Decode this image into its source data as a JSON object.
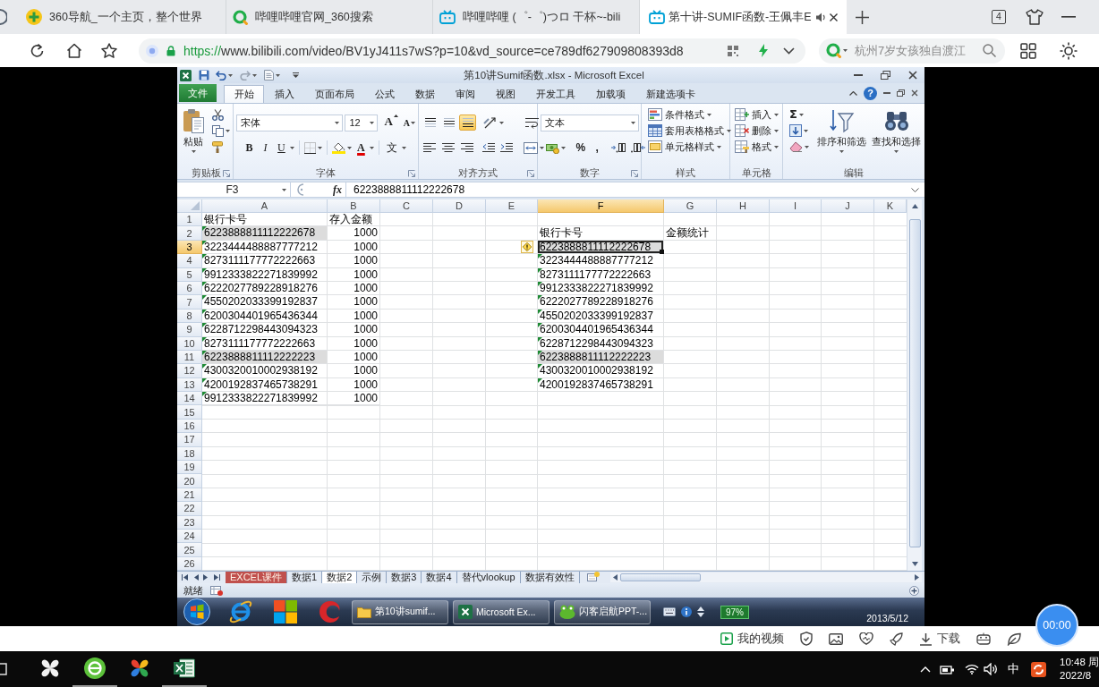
{
  "browser": {
    "tabs": [
      {
        "kind": "portal",
        "title": "360导航_一个主页，整个世界",
        "selected": false,
        "audio": false
      },
      {
        "kind": "search",
        "title": "哔哩哔哩官网_360搜索",
        "selected": false,
        "audio": false
      },
      {
        "kind": "video",
        "title": "哔哩哔哩 (゜-゜)つロ 干杯~-bili",
        "selected": false,
        "audio": false
      },
      {
        "kind": "video",
        "title": "第十讲-SUMIF函数-王佩丰E",
        "selected": true,
        "audio": true
      }
    ],
    "tab_count": "4"
  },
  "address_bar": {
    "scheme": "https://",
    "url": "www.bilibili.com/video/BV1yJ411s7wS?p=10&vd_source=ce789df627909808393d8"
  },
  "search": {
    "placeholder": "杭州7岁女孩独自渡江"
  },
  "excel": {
    "title": "第10讲Sumif函数.xlsx - Microsoft Excel",
    "file_tab": "文件",
    "tabs": [
      {
        "label": "开始",
        "selected": true
      },
      {
        "label": "插入",
        "selected": false
      },
      {
        "label": "页面布局",
        "selected": false
      },
      {
        "label": "公式",
        "selected": false
      },
      {
        "label": "数据",
        "selected": false
      },
      {
        "label": "审阅",
        "selected": false
      },
      {
        "label": "视图",
        "selected": false
      },
      {
        "label": "开发工具",
        "selected": false
      },
      {
        "label": "加载项",
        "selected": false
      },
      {
        "label": "新建选项卡",
        "selected": false
      }
    ],
    "help": "?",
    "ribbon": {
      "clipboard": {
        "label": "剪贴板",
        "paste": "粘贴"
      },
      "font": {
        "label": "字体",
        "font_name": "宋体",
        "font_size": "12",
        "grow": "A",
        "shrink": "A",
        "buttons": [
          {
            "kind": "bold",
            "label": "B"
          },
          {
            "kind": "italic",
            "label": "I"
          },
          {
            "kind": "underline",
            "label": "U"
          },
          {
            "kind": "border"
          },
          {
            "kind": "fill"
          },
          {
            "kind": "color",
            "label": "A"
          },
          {
            "kind": "phonetic",
            "label": "文"
          }
        ]
      },
      "alignment": {
        "label": "对齐方式",
        "vertical": [
          {
            "kind": "top",
            "selected": false
          },
          {
            "kind": "middle",
            "selected": false
          },
          {
            "kind": "bottom",
            "selected": true
          }
        ]
      },
      "number": {
        "label": "数字",
        "format": "文本",
        "percent": "%",
        "comma": ","
      },
      "styles": {
        "label": "样式",
        "items": [
          {
            "kind": "conditional",
            "label": "条件格式"
          },
          {
            "kind": "table",
            "label": "套用表格格式"
          },
          {
            "kind": "cell",
            "label": "单元格样式"
          }
        ]
      },
      "cells": {
        "label": "单元格",
        "items": [
          {
            "kind": "insert",
            "label": "插入"
          },
          {
            "kind": "delete",
            "label": "删除"
          },
          {
            "kind": "format",
            "label": "格式"
          }
        ]
      },
      "editing": {
        "label": "编辑",
        "sum": "Σ",
        "sort": "排序和筛选",
        "find": "查找和选择"
      }
    },
    "name_box": "F3",
    "fx": "fx",
    "formula": "6223888811112222678",
    "columns": [
      {
        "label": "A",
        "selected": false
      },
      {
        "label": "B",
        "selected": false
      },
      {
        "label": "C",
        "selected": false
      },
      {
        "label": "D",
        "selected": false
      },
      {
        "label": "E",
        "selected": false
      },
      {
        "label": "F",
        "selected": true
      },
      {
        "label": "G",
        "selected": false
      },
      {
        "label": "H",
        "selected": false
      },
      {
        "label": "I",
        "selected": false
      },
      {
        "label": "J",
        "selected": false
      },
      {
        "label": "K",
        "selected": false
      }
    ],
    "rows": [
      {
        "label": "1",
        "selected": false
      },
      {
        "label": "2",
        "selected": false
      },
      {
        "label": "3",
        "selected": true
      },
      {
        "label": "4",
        "selected": false
      },
      {
        "label": "5",
        "selected": false
      },
      {
        "label": "6",
        "selected": false
      },
      {
        "label": "7",
        "selected": false
      },
      {
        "label": "8",
        "selected": false
      },
      {
        "label": "9",
        "selected": false
      },
      {
        "label": "10",
        "selected": false
      },
      {
        "label": "11",
        "selected": false
      },
      {
        "label": "12",
        "selected": false
      },
      {
        "label": "13",
        "selected": false
      },
      {
        "label": "14",
        "selected": false
      },
      {
        "label": "15",
        "selected": false
      },
      {
        "label": "16",
        "selected": false
      },
      {
        "label": "17",
        "selected": false
      },
      {
        "label": "18",
        "selected": false
      },
      {
        "label": "19",
        "selected": false
      },
      {
        "label": "20",
        "selected": false
      },
      {
        "label": "21",
        "selected": false
      },
      {
        "label": "22",
        "selected": false
      },
      {
        "label": "23",
        "selected": false
      },
      {
        "label": "24",
        "selected": false
      },
      {
        "label": "25",
        "selected": false
      },
      {
        "label": "26",
        "selected": false
      }
    ],
    "deposit_table": {
      "headers": [
        "银行卡号",
        "存入金额"
      ],
      "rows": [
        {
          "card": "6223888811112222678",
          "amount": "1000",
          "flagged": true,
          "highlighted": true,
          "selected": false
        },
        {
          "card": "3223444488887777212",
          "amount": "1000",
          "flagged": true,
          "highlighted": false,
          "selected": false
        },
        {
          "card": "8273111177772222663",
          "amount": "1000",
          "flagged": true,
          "highlighted": false,
          "selected": false
        },
        {
          "card": "9912333822271839992",
          "amount": "1000",
          "flagged": true,
          "highlighted": false,
          "selected": false
        },
        {
          "card": "6222027789228918276",
          "amount": "1000",
          "flagged": true,
          "highlighted": false,
          "selected": false
        },
        {
          "card": "4550202033399192837",
          "amount": "1000",
          "flagged": true,
          "highlighted": false,
          "selected": false
        },
        {
          "card": "6200304401965436344",
          "amount": "1000",
          "flagged": true,
          "highlighted": false,
          "selected": false
        },
        {
          "card": "6228712298443094323",
          "amount": "1000",
          "flagged": true,
          "highlighted": false,
          "selected": false
        },
        {
          "card": "8273111177772222663",
          "amount": "1000",
          "flagged": true,
          "highlighted": false,
          "selected": false
        },
        {
          "card": "6223888811112222223",
          "amount": "1000",
          "flagged": true,
          "highlighted": true,
          "selected": false
        },
        {
          "card": "4300320010002938192",
          "amount": "1000",
          "flagged": true,
          "highlighted": false,
          "selected": false
        },
        {
          "card": "4200192837465738291",
          "amount": "1000",
          "flagged": true,
          "highlighted": false,
          "selected": false
        },
        {
          "card": "9912333822271839992",
          "amount": "1000",
          "flagged": true,
          "highlighted": false,
          "selected": false
        }
      ]
    },
    "card_list": {
      "header": "银行卡号",
      "rows": [
        {
          "card": "6223888811112222678",
          "flagged": false,
          "highlighted": true,
          "selected": true
        },
        {
          "card": "3223444488887777212",
          "flagged": true,
          "highlighted": false,
          "selected": false
        },
        {
          "card": "8273111177772222663",
          "flagged": true,
          "highlighted": false,
          "selected": false
        },
        {
          "card": "9912333822271839992",
          "flagged": true,
          "highlighted": false,
          "selected": false
        },
        {
          "card": "6222027789228918276",
          "flagged": true,
          "highlighted": false,
          "selected": false
        },
        {
          "card": "4550202033399192837",
          "flagged": true,
          "highlighted": false,
          "selected": false
        },
        {
          "card": "6200304401965436344",
          "flagged": true,
          "highlighted": false,
          "selected": false
        },
        {
          "card": "6228712298443094323",
          "flagged": true,
          "highlighted": false,
          "selected": false
        },
        {
          "card": "6223888811112222223",
          "flagged": true,
          "highlighted": true,
          "selected": false
        },
        {
          "card": "4300320010002938192",
          "flagged": true,
          "highlighted": false,
          "selected": false
        },
        {
          "card": "4200192837465738291",
          "flagged": true,
          "highlighted": false,
          "selected": false
        }
      ]
    },
    "total_header": "金额统计",
    "sheet_tabs": [
      {
        "label": "EXCEL课件",
        "selected": false,
        "color": "#c0504d"
      },
      {
        "label": "数据1",
        "selected": false
      },
      {
        "label": "数据2",
        "selected": true
      },
      {
        "label": "示例",
        "selected": false
      },
      {
        "label": "数据3",
        "selected": false
      },
      {
        "label": "数据4",
        "selected": false
      },
      {
        "label": "替代vlookup",
        "selected": false
      },
      {
        "label": "数据有效性",
        "selected": false
      }
    ],
    "status": "就绪",
    "taskbar": {
      "buttons": [
        {
          "kind": "folder",
          "label": "第10讲sumif..."
        },
        {
          "kind": "excel",
          "label": "Microsoft Ex..."
        },
        {
          "kind": "frog",
          "label": "闪客启航PPT-..."
        }
      ],
      "tray_badge": "97%",
      "date": "2013/5/12"
    }
  },
  "player_bar": {
    "my_videos": "我的视频",
    "download": "下载",
    "timer": "00:00"
  },
  "os_taskbar": {
    "apps": [
      {
        "kind": "pinwheel",
        "running": false
      },
      {
        "kind": "orb",
        "running": true
      },
      {
        "kind": "colorful",
        "running": false
      },
      {
        "kind": "excel",
        "running": true
      }
    ],
    "ime": "中",
    "time": "10:48 周",
    "date": "2022/8"
  }
}
